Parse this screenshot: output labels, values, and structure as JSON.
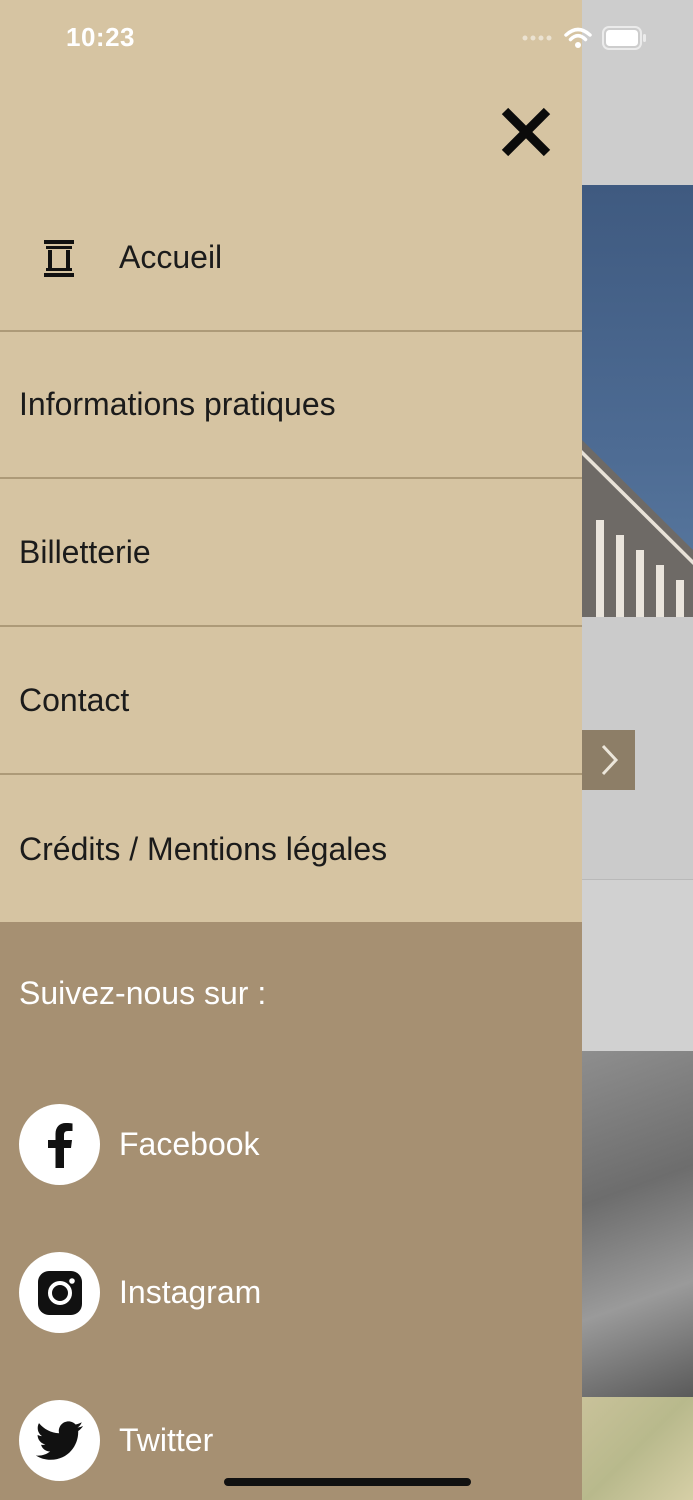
{
  "status_bar": {
    "time": "10:23"
  },
  "menu": {
    "close_icon": "close-icon",
    "items": [
      {
        "label": "Accueil",
        "icon": "museum-icon"
      },
      {
        "label": "Informations pratiques"
      },
      {
        "label": "Billetterie"
      },
      {
        "label": "Contact"
      },
      {
        "label": "Crédits / Mentions légales"
      }
    ]
  },
  "social": {
    "title": "Suivez-nous sur :",
    "links": [
      {
        "label": "Facebook",
        "icon": "facebook-icon"
      },
      {
        "label": "Instagram",
        "icon": "instagram-icon"
      },
      {
        "label": "Twitter",
        "icon": "twitter-icon"
      }
    ]
  },
  "colors": {
    "drawer_background": "#d6c4a2",
    "social_background": "#a69072",
    "divider": "#ad9a78"
  }
}
